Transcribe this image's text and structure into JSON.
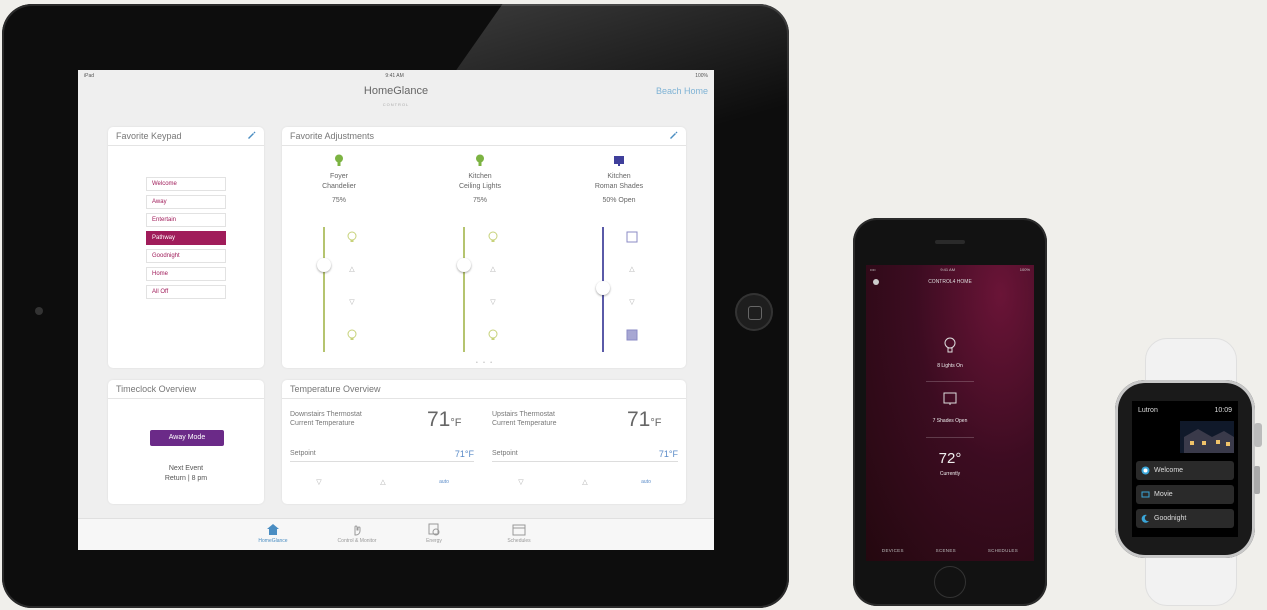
{
  "tablet": {
    "status": {
      "left": "iPad",
      "center": "9:41 AM",
      "right": "100%"
    },
    "nav": {
      "title": "HomeGlance",
      "right": "Beach Home"
    },
    "subtitle": "CONTROL",
    "favorite_keypad": {
      "title": "Favorite Keypad",
      "buttons": [
        "Welcome",
        "Away",
        "Entertain",
        "Pathway",
        "Goodnight",
        "Home",
        "All Off"
      ],
      "active": "Pathway"
    },
    "favorite_adjustments": {
      "title": "Favorite Adjustments",
      "devices": [
        {
          "name_line1": "Foyer",
          "name_line2": "Chandelier",
          "value": "75%",
          "level": 0.75,
          "type": "light"
        },
        {
          "name_line1": "Kitchen",
          "name_line2": "Ceiling Lights",
          "value": "75%",
          "level": 0.75,
          "type": "light"
        },
        {
          "name_line1": "Kitchen",
          "name_line2": "Roman Shades",
          "value": "50% Open",
          "level": 0.5,
          "type": "shade"
        }
      ],
      "colors": {
        "light_icon": "#7cb342",
        "shade_icon": "#3f3f9b",
        "light_track": "#b5c46f",
        "shade_track": "#5a5aa8"
      }
    },
    "timeclock": {
      "title": "Timeclock Overview",
      "mode_button": "Away Mode",
      "next_event_line1": "Next Event",
      "next_event_line2": "Return | 8 pm"
    },
    "temperature": {
      "title": "Temperature Overview",
      "zones": [
        {
          "name_line1": "Downstairs Thermostat",
          "name_line2": "Current Temperature",
          "temp": "71",
          "unit": "°F",
          "setpoint_label": "Setpoint",
          "setpoint": "71°F",
          "mode": "auto"
        },
        {
          "name_line1": "Upstairs Thermostat",
          "name_line2": "Current Temperature",
          "temp": "71",
          "unit": "°F",
          "setpoint_label": "Setpoint",
          "setpoint": "71°F",
          "mode": "auto"
        }
      ]
    },
    "tabs": [
      {
        "label": "HomeGlance",
        "icon": "home-icon",
        "active": true
      },
      {
        "label": "Control & Monitor",
        "icon": "hand-icon",
        "active": false
      },
      {
        "label": "Energy",
        "icon": "energy-icon",
        "active": false
      },
      {
        "label": "Schedules",
        "icon": "calendar-icon",
        "active": false
      }
    ],
    "accent": "#a01c5a",
    "link_color": "#4a8dc2"
  },
  "phone": {
    "status": {
      "left": "•••• ",
      "center": "9:41 AM",
      "right": "100%"
    },
    "title": "CONTROL4 HOME",
    "stats": [
      {
        "value": "8 Lights On",
        "icon": "bulb-icon"
      },
      {
        "value": "7 Shades Open",
        "icon": "shade-icon"
      },
      {
        "value": "72°",
        "label": "Currently",
        "icon": "thermometer"
      }
    ],
    "bottom_tabs": [
      "DEVICES",
      "SCENES",
      "SCHEDULES"
    ],
    "bg_color": "#3c0c21"
  },
  "watch": {
    "title": "Lutron",
    "time": "10:09",
    "items": [
      {
        "label": "Welcome",
        "icon": "circle-icon",
        "selected": true
      },
      {
        "label": "Movie",
        "icon": "tv-icon",
        "selected": false
      },
      {
        "label": "Goodnight",
        "icon": "moon-icon",
        "selected": false
      }
    ]
  }
}
